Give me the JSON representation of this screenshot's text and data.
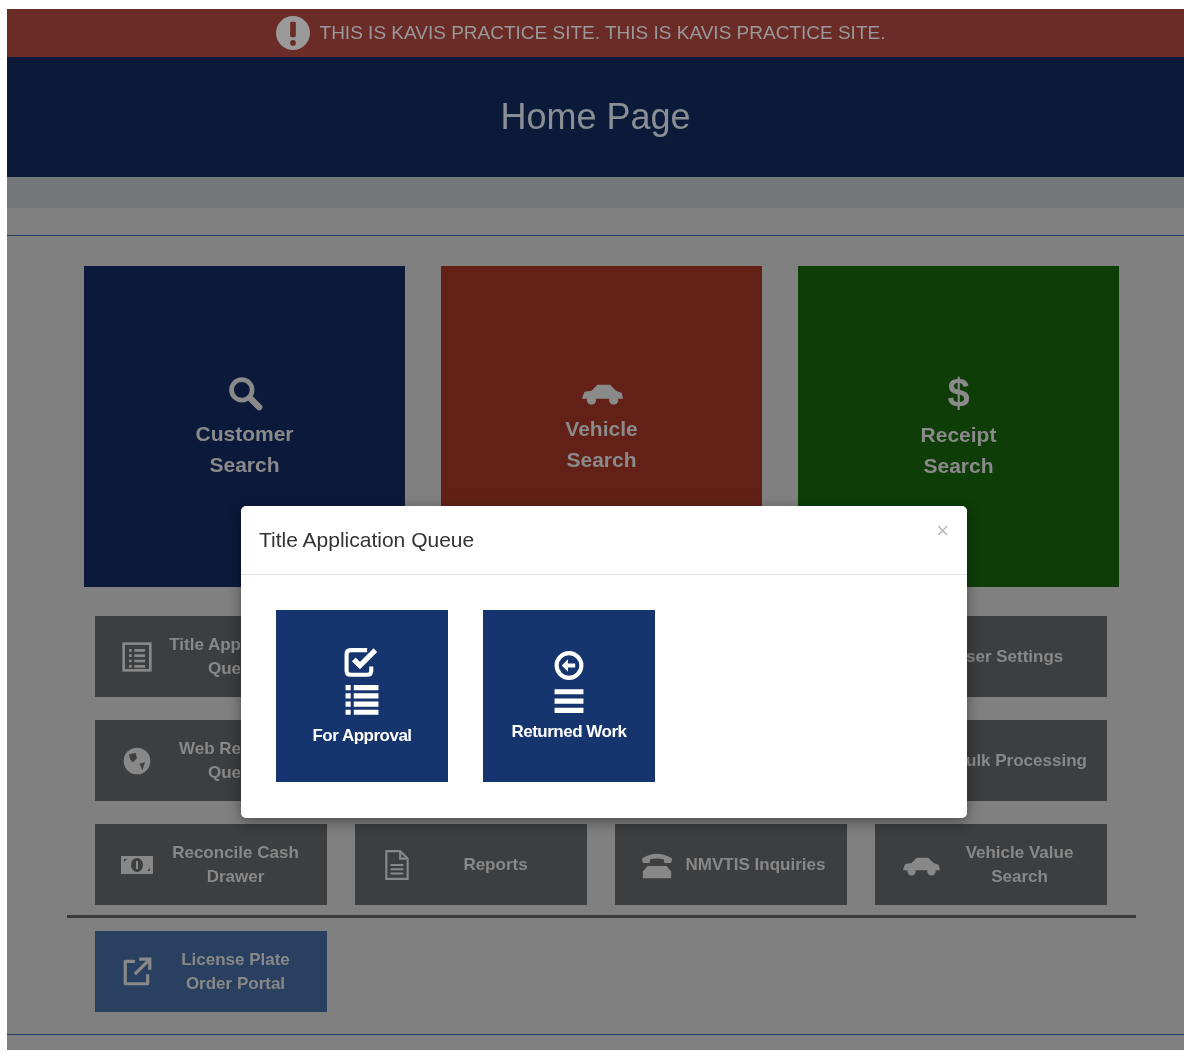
{
  "banner": {
    "text": "THIS IS KAVIS PRACTICE SITE. THIS IS KAVIS PRACTICE SITE."
  },
  "header": {
    "title": "Home Page"
  },
  "big_tiles": [
    {
      "lines": [
        "Customer",
        "Search"
      ],
      "color": "#0b1a3a"
    },
    {
      "lines": [
        "Vehicle",
        "Search"
      ],
      "color": "#622016"
    },
    {
      "icon_char": "$",
      "lines": [
        "Receipt",
        "Search"
      ],
      "color": "#0e3d08"
    }
  ],
  "tile_rows": [
    [
      {
        "kind": "cut_right",
        "lines": [
          "Title App",
          "Que"
        ]
      },
      {
        "kind": "cut_left",
        "lines": [
          "ser Settings"
        ]
      }
    ],
    [
      {
        "kind": "cut_right",
        "lines": [
          "Web Re",
          "Que"
        ]
      },
      {
        "kind": "cut_left",
        "lines": [
          "ulk Processing"
        ]
      }
    ],
    [
      {
        "kind": "full",
        "lines": [
          "Reconcile Cash",
          "Drawer"
        ]
      },
      {
        "kind": "full",
        "lines": [
          "Reports"
        ]
      },
      {
        "kind": "full",
        "lines": [
          "NMVTIS Inquiries"
        ]
      },
      {
        "kind": "full",
        "lines": [
          "Vehicle Value",
          "Search"
        ]
      }
    ]
  ],
  "link_tiles": [
    {
      "kind": "link",
      "lines": [
        "License Plate",
        "Order Portal"
      ]
    }
  ],
  "modal": {
    "title": "Title Application Queue",
    "close": "×",
    "buttons": [
      {
        "label": "For Approval"
      },
      {
        "label": "Returned Work"
      }
    ]
  }
}
